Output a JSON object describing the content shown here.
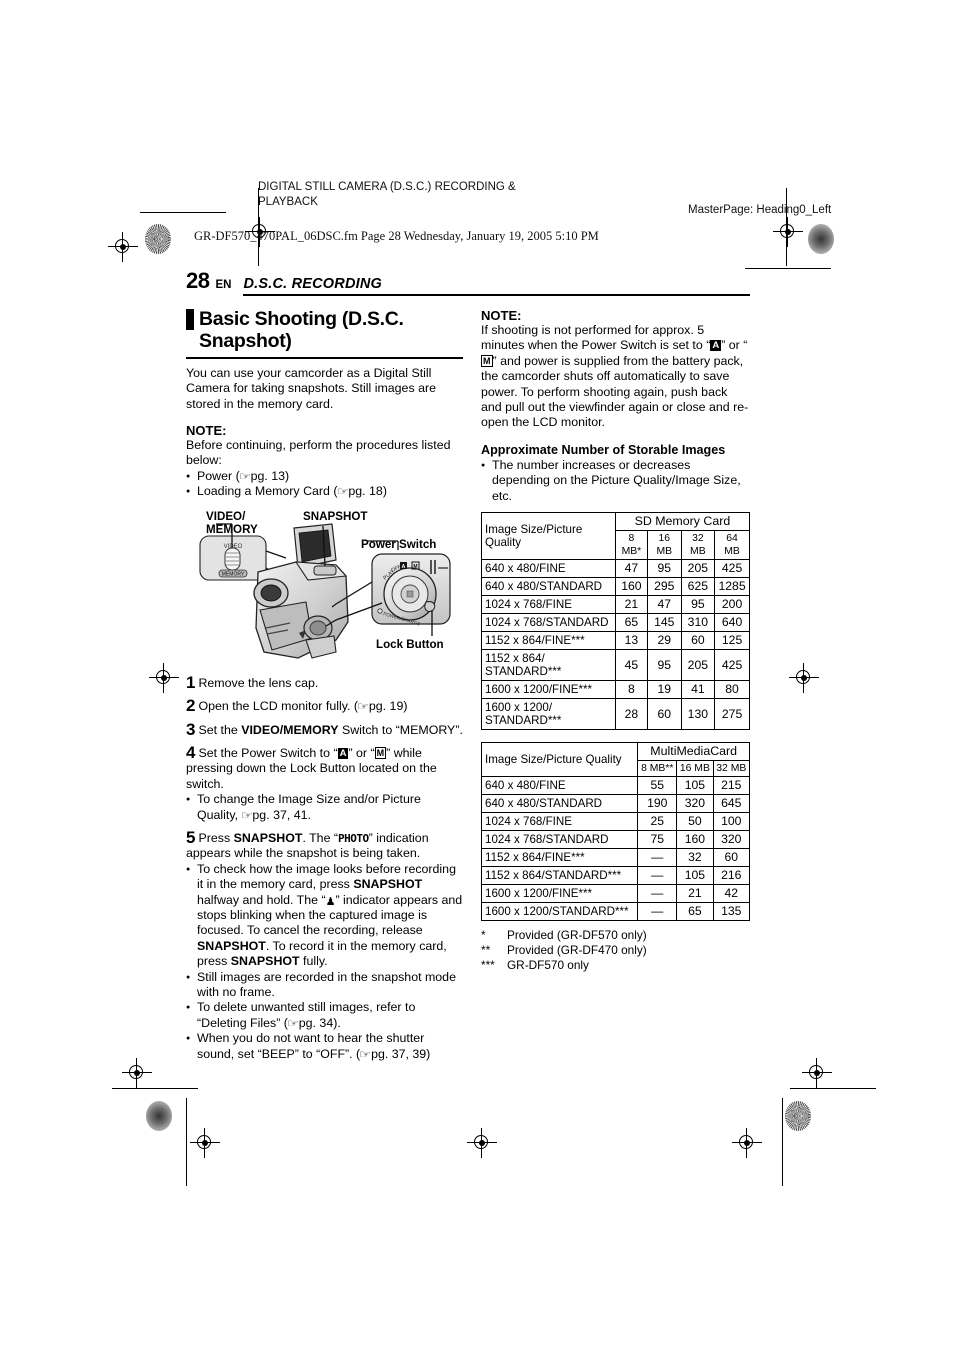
{
  "prepress": {
    "master_note": "DIGITAL STILL CAMERA (D.S.C.) RECORDING &\nPLAYBACK",
    "master_page": "MasterPage: Heading0_Left",
    "file_line": "GR-DF570_470PAL_06DSC.fm  Page 28  Wednesday, January 19, 2005  5:10 PM"
  },
  "page_header": {
    "page_number": "28",
    "region": "EN",
    "section": "D.S.C. RECORDING"
  },
  "left_column": {
    "chapter_title": "Basic Shooting (D.S.C. Snapshot)",
    "intro": "You can use your camcorder as a Digital Still Camera for taking snapshots. Still images are stored in the memory card.",
    "note_label": "NOTE:",
    "note_text": "Before continuing, perform the procedures listed below:",
    "note_bullets": [
      {
        "text": "Power (",
        "ref": "pg. 13",
        "tail": ")"
      },
      {
        "text": "Loading a Memory Card (",
        "ref": "pg. 18",
        "tail": ")"
      }
    ],
    "illustration": {
      "label_video_memory": "VIDEO/\nMEMORY",
      "label_snapshot": "SNAPSHOT",
      "label_power_switch": "Power Switch",
      "label_lock_button": "Lock Button",
      "switch_top_text": "VIDEO",
      "switch_bottom_text": "MEMORY",
      "dial_text": "POWER/CHARGE"
    },
    "steps": [
      {
        "num": "1",
        "html": "Remove the lens cap."
      },
      {
        "num": "2",
        "html": "Open the LCD monitor fully. (☞ pg. 19)"
      },
      {
        "num": "3",
        "html": "Set the VIDEO/MEMORY Switch to “MEMORY”."
      },
      {
        "num": "4",
        "html": "Set the Power Switch to “A” or “M” while pressing down the Lock Button located on the switch."
      },
      {
        "num": "5",
        "html": "Press SNAPSHOT. The “PHOTO” indication appears while the snapshot is being taken."
      }
    ],
    "step4_bullets": [
      "To change the Image Size and/or Picture Quality, ☞ pg. 37, 41."
    ],
    "step5_bullets": [
      "To check how the image looks before recording it in the memory card, press SNAPSHOT halfway and hold. The “♟” indicator appears and stops blinking when the captured image is focused. To cancel the recording, release SNAPSHOT. To record it in the memory card, press SNAPSHOT fully.",
      "Still images are recorded in the snapshot mode with no frame.",
      "To delete unwanted still images, refer to “Deleting Files” (☞ pg. 34).",
      "When you do not want to hear the shutter sound, set “BEEP” to “OFF”. (☞ pg. 37, 39)"
    ]
  },
  "right_column": {
    "note_label": "NOTE:",
    "note_text": "If shooting is not performed for approx. 5 minutes when the Power Switch is set to “A” or “M” and power is supplied from the battery pack, the camcorder shuts off automatically to save power. To perform shooting again, push back and pull out the viewfinder again or close and re-open the LCD monitor.",
    "storable_heading": "Approximate Number of Storable Images",
    "storable_bullet": "The number increases or decreases depending on the Picture Quality/Image Size, etc.",
    "footnotes": [
      {
        "mark": "*",
        "text": "Provided (GR-DF570 only)"
      },
      {
        "mark": "**",
        "text": "Provided (GR-DF470 only)"
      },
      {
        "mark": "***",
        "text": "GR-DF570 only"
      }
    ]
  },
  "chart_data": [
    {
      "type": "table",
      "title": "SD Memory Card",
      "corner_header": "Image Size/Picture Quality",
      "categories": [
        "8 MB*",
        "16 MB",
        "32 MB",
        "64 MB"
      ],
      "rows": [
        {
          "label": "640 x 480/FINE",
          "values": [
            "47",
            "95",
            "205",
            "425"
          ]
        },
        {
          "label": "640 x 480/STANDARD",
          "values": [
            "160",
            "295",
            "625",
            "1285"
          ]
        },
        {
          "label": "1024 x 768/FINE",
          "values": [
            "21",
            "47",
            "95",
            "200"
          ]
        },
        {
          "label": "1024 x 768/STANDARD",
          "values": [
            "65",
            "145",
            "310",
            "640"
          ]
        },
        {
          "label": "1152 x 864/FINE***",
          "values": [
            "13",
            "29",
            "60",
            "125"
          ]
        },
        {
          "label": "1152 x 864/\nSTANDARD***",
          "values": [
            "45",
            "95",
            "205",
            "425"
          ]
        },
        {
          "label": "1600 x 1200/FINE***",
          "values": [
            "8",
            "19",
            "41",
            "80"
          ]
        },
        {
          "label": "1600 x 1200/\nSTANDARD***",
          "values": [
            "28",
            "60",
            "130",
            "275"
          ]
        }
      ]
    },
    {
      "type": "table",
      "title": "MultiMediaCard",
      "corner_header": "Image Size/Picture Quality",
      "categories": [
        "8 MB**",
        "16 MB",
        "32 MB"
      ],
      "rows": [
        {
          "label": "640 x 480/FINE",
          "values": [
            "55",
            "105",
            "215"
          ]
        },
        {
          "label": "640 x 480/STANDARD",
          "values": [
            "190",
            "320",
            "645"
          ]
        },
        {
          "label": "1024 x 768/FINE",
          "values": [
            "25",
            "50",
            "100"
          ]
        },
        {
          "label": "1024 x 768/STANDARD",
          "values": [
            "75",
            "160",
            "320"
          ]
        },
        {
          "label": "1152 x 864/FINE***",
          "values": [
            "—",
            "32",
            "60"
          ]
        },
        {
          "label": "1152 x 864/STANDARD***",
          "values": [
            "—",
            "105",
            "216"
          ]
        },
        {
          "label": "1600 x 1200/FINE***",
          "values": [
            "—",
            "21",
            "42"
          ]
        },
        {
          "label": "1600 x 1200/STANDARD***",
          "values": [
            "—",
            "65",
            "135"
          ]
        }
      ]
    }
  ]
}
